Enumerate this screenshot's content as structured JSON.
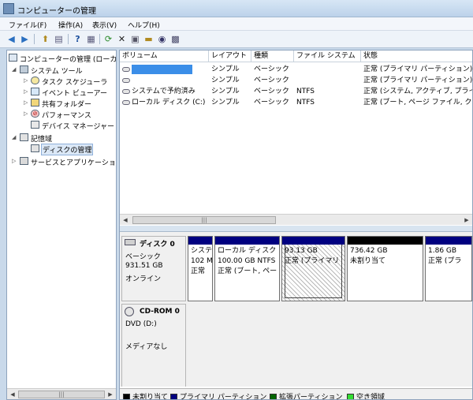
{
  "window": {
    "title": "コンピューターの管理"
  },
  "menu": [
    "ファイル(F)",
    "操作(A)",
    "表示(V)",
    "ヘルプ(H)"
  ],
  "toolbar": {
    "icons": [
      "back-icon",
      "forward-icon",
      "up-folder-icon",
      "show-hide-tree-icon",
      "help-icon",
      "console-view-icon",
      "refresh-icon",
      "delete-icon",
      "properties-icon",
      "open-folder-icon",
      "search-disk-icon",
      "settings-icon"
    ]
  },
  "tree": {
    "root": "コンピューターの管理 (ローカル)",
    "system_tools": "システム ツール",
    "task_scheduler": "タスク スケジューラ",
    "event_viewer": "イベント ビューアー",
    "shared_folders": "共有フォルダー",
    "performance": "パフォーマンス",
    "device_manager": "デバイス マネージャー",
    "storage": "記憶域",
    "disk_management": "ディスクの管理",
    "services": "サービスとアプリケーション"
  },
  "volumes": {
    "headers": [
      "ボリューム",
      "レイアウト",
      "種類",
      "ファイル システム",
      "状態"
    ],
    "rows": [
      {
        "name": "",
        "layout": "シンプル",
        "type": "ベーシック",
        "fs": "",
        "status": "正常 (プライマリ パーティション)",
        "redacted": true
      },
      {
        "name": "",
        "layout": "シンプル",
        "type": "ベーシック",
        "fs": "",
        "status": "正常 (プライマリ パーティション)",
        "redacted": false
      },
      {
        "name": "システムで予約済み",
        "layout": "シンプル",
        "type": "ベーシック",
        "fs": "NTFS",
        "status": "正常 (システム, アクティブ, プライマリ)",
        "redacted": false
      },
      {
        "name": "ローカル ディスク (C:)",
        "layout": "シンプル",
        "type": "ベーシック",
        "fs": "NTFS",
        "status": "正常 (ブート, ページ ファイル, クラッシュ)",
        "redacted": false
      }
    ]
  },
  "disk0": {
    "name": "ディスク 0",
    "kind": "ベーシック",
    "size": "931.51 GB",
    "state": "オンライン",
    "partitions": [
      {
        "line1": "システ",
        "line2": "102 M",
        "line3": "正常",
        "bar": "#000080"
      },
      {
        "line1": "ローカル ディスク",
        "line2": "100.00 GB NTFS",
        "line3": "正常 (ブート, ペー",
        "bar": "#000080"
      },
      {
        "line1": "93.13 GB",
        "line2": "正常 (プライマリ",
        "line3": "",
        "bar": "#000080"
      },
      {
        "line1": "736.42 GB",
        "line2": "未割り当て",
        "line3": "",
        "bar": "#000000"
      },
      {
        "line1": "1.86 GB",
        "line2": "正常 (プラ",
        "line3": "",
        "bar": "#000080"
      }
    ]
  },
  "cdrom0": {
    "name": "CD-ROM 0",
    "drive": "DVD (D:)",
    "media": "メディアなし"
  },
  "legend": [
    {
      "label": "未割り当て",
      "color": "#000000"
    },
    {
      "label": "プライマリ パーティション",
      "color": "#000080"
    },
    {
      "label": "拡張パーティション",
      "color": "#006400"
    },
    {
      "label": "空き領域",
      "color": "#33dd33"
    }
  ]
}
